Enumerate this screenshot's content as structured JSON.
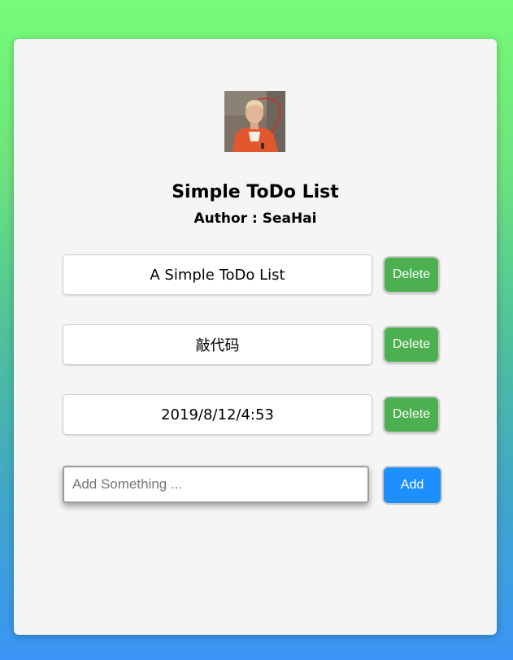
{
  "header": {
    "title": "Simple ToDo List",
    "author": "Author : SeaHai"
  },
  "todos": [
    {
      "text": "A Simple ToDo List",
      "delete_label": "Delete"
    },
    {
      "text": "敲代码",
      "delete_label": "Delete"
    },
    {
      "text": "2019/8/12/4:53",
      "delete_label": "Delete"
    }
  ],
  "add_form": {
    "placeholder": "Add Something ...",
    "value": "",
    "add_label": "Add"
  },
  "colors": {
    "delete_button": "#4caf50",
    "add_button": "#1e8fff",
    "card": "#f5f5f5"
  },
  "icons": {
    "avatar": "profile-photo"
  }
}
